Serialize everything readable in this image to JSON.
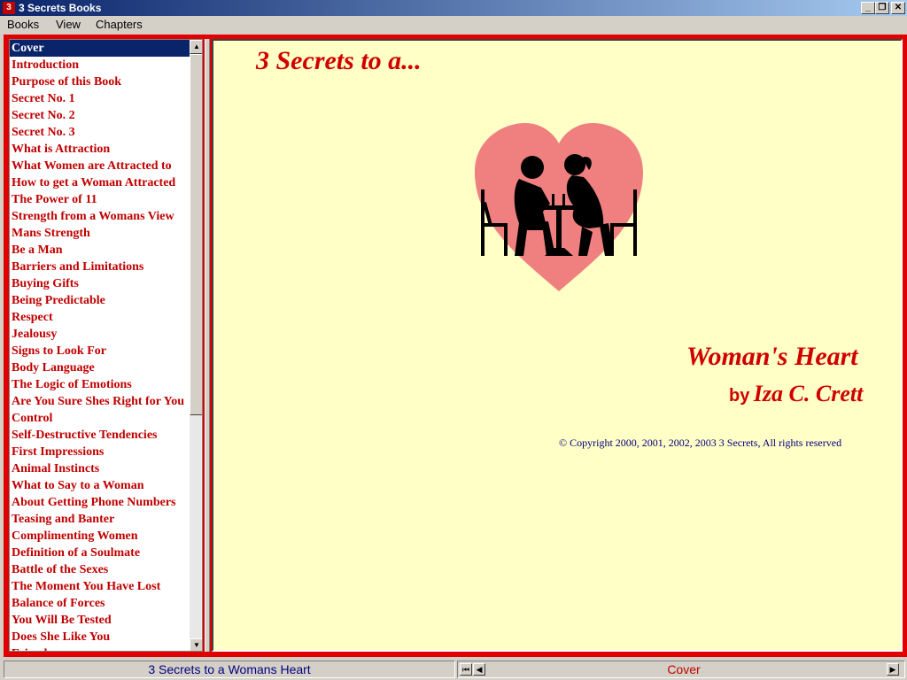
{
  "window": {
    "title": "3 Secrets Books",
    "controls": {
      "minimize": "_",
      "maximize": "❐",
      "close": "✕"
    }
  },
  "menu": [
    {
      "label": "Books"
    },
    {
      "label": "View"
    },
    {
      "label": "Chapters"
    }
  ],
  "toc": {
    "selected_index": 0,
    "items": [
      "Cover",
      "Introduction",
      "Purpose of this Book",
      "Secret No. 1",
      "Secret No. 2",
      "Secret No. 3",
      "What is Attraction",
      "What Women are Attracted to",
      "How to get a Woman Attracted",
      "The Power of 11",
      "Strength from a Womans View",
      "Mans Strength",
      "Be a Man",
      "Barriers and Limitations",
      "Buying Gifts",
      "Being Predictable",
      "Respect",
      "Jealousy",
      "Signs to Look For",
      "Body Language",
      "The Logic of Emotions",
      "Are You Sure Shes Right for You",
      "Control",
      "Self-Destructive Tendencies",
      "First Impressions",
      "Animal Instincts",
      "What to Say to a Woman",
      "About Getting Phone Numbers",
      "Teasing and Banter",
      "Complimenting Women",
      "Definition of a Soulmate",
      "Battle of the Sexes",
      "The Moment You Have Lost",
      "Balance of Forces",
      "You Will Be Tested",
      "Does She Like You",
      "Friends"
    ]
  },
  "content": {
    "logo_text": "3 Secrets to a...",
    "book_title": "Woman's Heart",
    "by_label": "by",
    "author": "Iza C. Crett",
    "copyright": "© Copyright 2000, 2001, 2002, 2003 3 Secrets, All rights reserved"
  },
  "status": {
    "book": "3 Secrets to a Womans Heart",
    "chapter": "Cover",
    "nav": {
      "first": "⏮",
      "prev": "◀",
      "next": "▶"
    }
  },
  "colors": {
    "frame": "#e00000",
    "content_bg": "#ffffc6",
    "toc_text": "#c00000",
    "heart": "#f08080",
    "selection": "#0a246a"
  }
}
